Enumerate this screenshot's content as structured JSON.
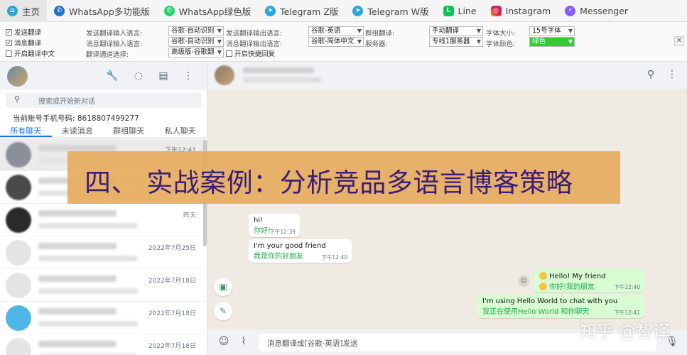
{
  "tabs": [
    {
      "label": "主页",
      "color": "#2aa4d8"
    },
    {
      "label": "WhatsApp多功能版",
      "color": "#1e6fd0"
    },
    {
      "label": "WhatsApp绿色版",
      "color": "#25d366"
    },
    {
      "label": "Telegram Z版",
      "color": "#2ca5e0"
    },
    {
      "label": "Telegram W版",
      "color": "#2ca5e0"
    },
    {
      "label": "Line",
      "color": "#06c755"
    },
    {
      "label": "Instagram",
      "color": "#d6249f"
    },
    {
      "label": "Messenger",
      "color": "#8a5cf6"
    }
  ],
  "settings": {
    "send_translate": "发送翻译",
    "msg_translate": "消息翻译",
    "enable_cn_translate": "开启翻译中文",
    "send_input_lang_label": "发送翻译输入语言:",
    "send_input_lang": "谷歌-自动识别",
    "msg_input_lang_label": "消息翻译输入语言:",
    "msg_input_lang": "谷歌-自动识别",
    "channel_label": "翻译通道选择:",
    "channel": "高级版-谷歌翻",
    "send_output_lang_label": "发送翻译输出语言:",
    "send_output_lang": "谷歌-英语",
    "msg_output_lang_label": "消息翻译输出语言:",
    "msg_output_lang": "谷歌-简体中文",
    "quick_reply": "开启快捷回复",
    "group_translate_label": "群组翻译:",
    "group_translate": "手动翻译",
    "server_label": "服务器:",
    "server": "专线1服务器",
    "font_size_label": "字体大小:",
    "font_size": "15号字体",
    "font_color_label": "字体颜色:",
    "font_color": "绿色",
    "font_color_hex": "#33cc33",
    "close": "✕"
  },
  "sidebar": {
    "search_placeholder": "搜索或开始新对话",
    "account": "当前账号手机号码: 8618807499277",
    "filters": [
      "所有聊天",
      "未读消息",
      "群组聊天",
      "私人聊天"
    ],
    "chats": [
      {
        "time": "下午12:41"
      },
      {
        "time": ""
      },
      {
        "time": "昨天"
      },
      {
        "time": "2022年7月25日"
      },
      {
        "time": "2022年7月18日"
      },
      {
        "time": "2022年7月18日"
      },
      {
        "time": "2022年7月18日"
      }
    ]
  },
  "conversation": {
    "messages": [
      {
        "dir": "in",
        "orig": "hi!",
        "tr": "你好!",
        "time": "下午12:39"
      },
      {
        "dir": "in",
        "orig": "I'm your good friend",
        "tr": "我是你的好朋友",
        "time": "下午12:40"
      },
      {
        "dir": "out",
        "orig": "Hello! My friend",
        "tr": "你好!我的朋友",
        "time": "下午12:40"
      },
      {
        "dir": "out",
        "orig": "I'm using Hello World to chat with you",
        "tr": "我正在使用Hello World 和你聊天",
        "time": "下午12:41"
      }
    ],
    "composer_text": "消息翻译成[谷歌-英语]发送"
  },
  "banner": "四、 实战案例：分析竞品多语言博客策略",
  "watermark": "知乎 @智译"
}
